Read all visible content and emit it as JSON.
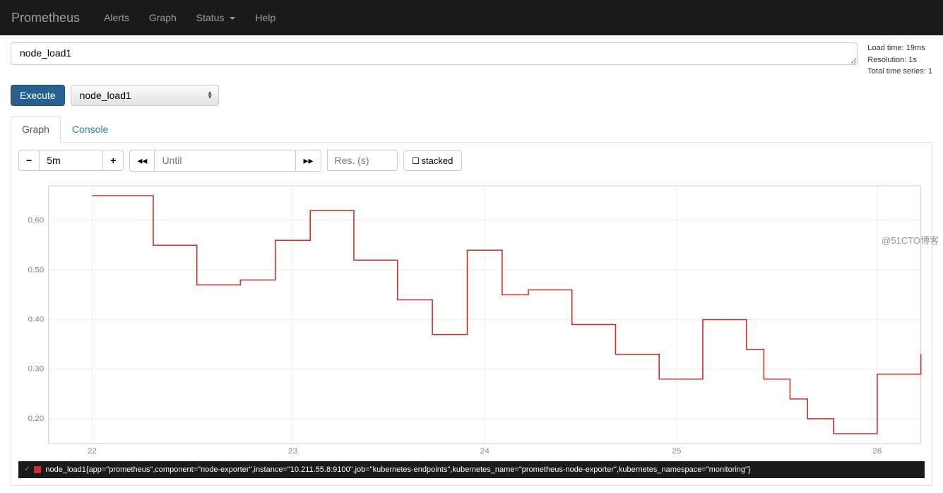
{
  "navbar": {
    "brand": "Prometheus",
    "items": [
      "Alerts",
      "Graph",
      "Status",
      "Help"
    ],
    "status_has_dropdown": true
  },
  "query": {
    "expression": "node_load1",
    "dropdown_selected": "node_load1"
  },
  "execute_label": "Execute",
  "stats": {
    "load_time": "Load time: 19ms",
    "resolution": "Resolution: 1s",
    "total_series": "Total time series: 1"
  },
  "tabs": {
    "graph": "Graph",
    "console": "Console",
    "active": "graph"
  },
  "range_controls": {
    "minus": "➖",
    "range_value": "5m",
    "plus": "➕",
    "back": "◀◀",
    "until_placeholder": "Until",
    "until_value": "",
    "forward": "▶▶",
    "res_placeholder": "Res. (s)",
    "res_value": "",
    "stacked_label": "stacked"
  },
  "legend": {
    "text": "node_load1{app=\"prometheus\",component=\"node-exporter\",instance=\"10.211.55.8:9100\",job=\"kubernetes-endpoints\",kubernetes_name=\"prometheus-node-exporter\",kubernetes_namespace=\"monitoring\"}"
  },
  "watermark": "@51CTO博客",
  "chart_data": {
    "type": "line",
    "title": "",
    "xlabel": "",
    "ylabel": "",
    "ylim": [
      0.15,
      0.67
    ],
    "y_ticks": [
      0.2,
      0.3,
      0.4,
      0.5,
      0.6
    ],
    "x_tick_labels": [
      "22",
      "23",
      "24",
      "25",
      "26"
    ],
    "x_tick_positions": [
      0.05,
      0.28,
      0.5,
      0.72,
      0.95
    ],
    "series": [
      {
        "name": "node_load1",
        "color": "#c9302c",
        "x": [
          0.05,
          0.1,
          0.12,
          0.15,
          0.17,
          0.2,
          0.22,
          0.24,
          0.26,
          0.28,
          0.3,
          0.33,
          0.35,
          0.37,
          0.4,
          0.42,
          0.44,
          0.47,
          0.48,
          0.5,
          0.52,
          0.55,
          0.57,
          0.6,
          0.62,
          0.65,
          0.67,
          0.7,
          0.72,
          0.75,
          0.77,
          0.8,
          0.82,
          0.85,
          0.87,
          0.9,
          0.92,
          0.95,
          1.0
        ],
        "y": [
          0.65,
          0.65,
          0.55,
          0.55,
          0.47,
          0.47,
          0.48,
          0.48,
          0.56,
          0.56,
          0.62,
          0.62,
          0.52,
          0.52,
          0.44,
          0.44,
          0.37,
          0.37,
          0.54,
          0.54,
          0.45,
          0.46,
          0.46,
          0.39,
          0.39,
          0.33,
          0.33,
          0.28,
          0.28,
          0.4,
          0.4,
          0.34,
          0.28,
          0.24,
          0.2,
          0.17,
          0.17,
          0.29,
          0.33,
          0.36,
          0.36
        ]
      }
    ]
  }
}
